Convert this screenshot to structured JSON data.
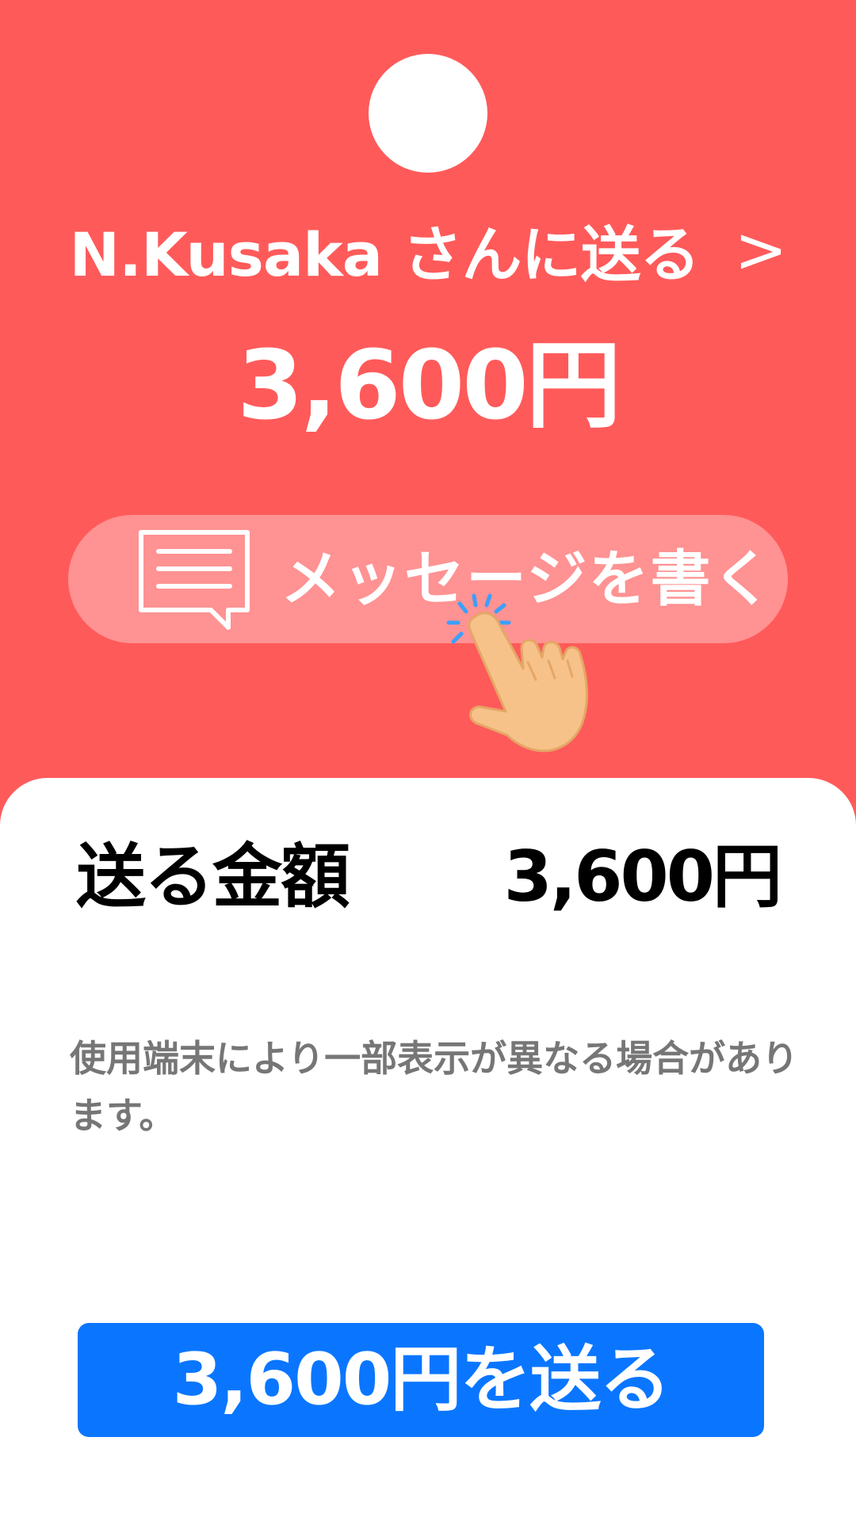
{
  "header": {
    "recipient_label": "N.Kusaka さんに送る",
    "chevron": ">",
    "amount": "3,600円"
  },
  "message_button": {
    "label": "メッセージを書く",
    "icon": "message-icon"
  },
  "summary": {
    "label": "送る金額",
    "value": "3,600円"
  },
  "notice": "使用端末により一部表示が異なる場合があります。",
  "send_button": {
    "label": "3,600円を送る"
  },
  "colors": {
    "background": "#ff5a5a",
    "message_button": "#ff9292",
    "send_button": "#0a76ff",
    "notice_text": "#767676"
  }
}
